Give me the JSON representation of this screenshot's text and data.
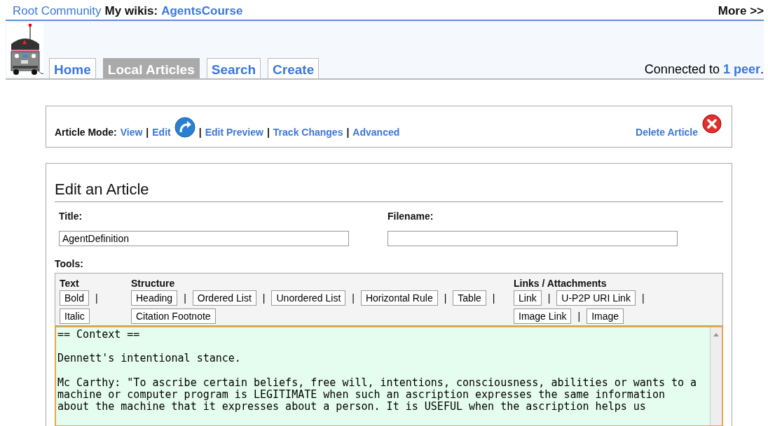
{
  "top_bar": {
    "community": "Root Community",
    "label": "My wikis:",
    "wiki": "AgentsCourse",
    "more": "More >>"
  },
  "tabs": [
    {
      "label": "Home",
      "selected": false
    },
    {
      "label": "Local Articles",
      "selected": true
    },
    {
      "label": "Search",
      "selected": false
    },
    {
      "label": "Create",
      "selected": false
    }
  ],
  "status": {
    "text": "Connected to",
    "link": "1 peer",
    "end": "."
  },
  "article_mode": {
    "label": "Article Mode:",
    "items": [
      {
        "kind": "link",
        "text": "View"
      },
      {
        "kind": "sep",
        "text": "|"
      },
      {
        "kind": "icon_link",
        "text": "Edit"
      },
      {
        "kind": "sep",
        "text": "|"
      },
      {
        "kind": "link",
        "text": "Edit Preview"
      },
      {
        "kind": "sep",
        "text": "|"
      },
      {
        "kind": "link",
        "text": "Track Changes"
      },
      {
        "kind": "sep",
        "text": "|"
      },
      {
        "kind": "link",
        "text": "Advanced"
      }
    ],
    "delete": "Delete Article"
  },
  "editor": {
    "heading": "Edit an Article",
    "title_label": "Title:",
    "title_value": "AgentDefinition",
    "filename_label": "Filename:",
    "tools_label": "Tools:",
    "tool_groups": [
      {
        "name": "Text",
        "lines": [
          {
            "items": [
              {
                "kind": "button",
                "text": "Bold"
              },
              {
                "kind": "sep",
                "text": "|"
              }
            ]
          },
          {
            "items": [
              {
                "kind": "button",
                "text": "Italic"
              }
            ]
          }
        ]
      },
      {
        "name": "Structure",
        "lines": [
          {
            "items": [
              {
                "kind": "button",
                "text": "Heading"
              },
              {
                "kind": "sep",
                "text": "|"
              },
              {
                "kind": "button",
                "text": "Ordered List"
              },
              {
                "kind": "sep",
                "text": "|"
              },
              {
                "kind": "button",
                "text": "Unordered List"
              },
              {
                "kind": "sep",
                "text": "|"
              },
              {
                "kind": "button",
                "text": "Horizontal Rule"
              },
              {
                "kind": "sep",
                "text": "|"
              },
              {
                "kind": "button",
                "text": "Table"
              },
              {
                "kind": "sep",
                "text": "|"
              }
            ]
          },
          {
            "items": [
              {
                "kind": "button",
                "text": "Citation Footnote"
              }
            ]
          }
        ]
      },
      {
        "name": "Links / Attachments",
        "lines": [
          {
            "items": [
              {
                "kind": "button",
                "text": "Link"
              },
              {
                "kind": "sep",
                "text": "|"
              },
              {
                "kind": "button",
                "text": "U-P2P URI Link"
              },
              {
                "kind": "sep",
                "text": "|"
              }
            ]
          },
          {
            "items": [
              {
                "kind": "button",
                "text": "Image Link"
              },
              {
                "kind": "sep",
                "text": "|"
              },
              {
                "kind": "button",
                "text": "Image"
              }
            ]
          }
        ]
      }
    ],
    "content": "== Context ==\n\nDennett's intentional stance.\n\nMc Carthy: \"To ascribe certain beliefs, free will, intentions, consciousness, abilities or wants to a\nmachine or computer program is LEGITIMATE when such an ascription expresses the same information\nabout the machine that it expresses about a person. It is USEFUL when the ascription helps us"
  }
}
